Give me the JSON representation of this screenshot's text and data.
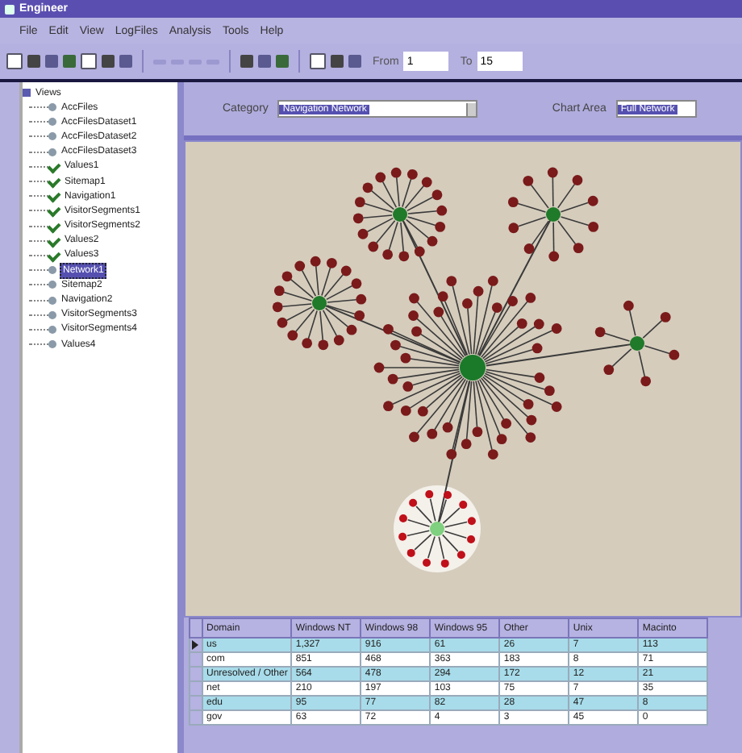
{
  "window": {
    "title": "Engineer"
  },
  "menu": [
    "File",
    "Edit",
    "View",
    "LogFiles",
    "Analysis",
    "Tools",
    "Help"
  ],
  "toolbar": {
    "from_label": "From",
    "from_value": "1",
    "to_label": "To",
    "to_value": "15"
  },
  "tree": {
    "label": "Views",
    "expanded": true,
    "children": [
      {
        "label": "AccFiles",
        "kind": "file",
        "selected": false
      },
      {
        "label": "AccFilesDataset1",
        "kind": "file",
        "selected": false
      },
      {
        "label": "AccFilesDataset2",
        "kind": "file",
        "selected": false
      },
      {
        "label": "AccFilesDataset3",
        "kind": "file",
        "selected": false
      },
      {
        "label": "Values1",
        "kind": "check",
        "selected": false
      },
      {
        "label": "Sitemap1",
        "kind": "check",
        "selected": false
      },
      {
        "label": "Navigation1",
        "kind": "check",
        "selected": false
      },
      {
        "label": "VisitorSegments1",
        "kind": "check",
        "selected": false
      },
      {
        "label": "VisitorSegments2",
        "kind": "check",
        "selected": false
      },
      {
        "label": "Values2",
        "kind": "check",
        "selected": false
      },
      {
        "label": "Values3",
        "kind": "check",
        "selected": false
      },
      {
        "label": "Network1",
        "kind": "file",
        "selected": true
      },
      {
        "label": "Sitemap2",
        "kind": "file",
        "selected": false
      },
      {
        "label": "Navigation2",
        "kind": "file",
        "selected": false
      },
      {
        "label": "VisitorSegments3",
        "kind": "file",
        "selected": false
      },
      {
        "label": "VisitorSegments4",
        "kind": "file",
        "selected": false
      },
      {
        "label": "Values4",
        "kind": "file",
        "selected": false
      }
    ]
  },
  "filters": {
    "category_label": "Category",
    "category_value": "Navigation Network",
    "chart_area_label": "Chart Area",
    "chart_area_value": "Full Network"
  },
  "table": {
    "columns": [
      "Domain",
      "Windows NT",
      "Windows 98",
      "Windows 95",
      "Other",
      "Unix",
      "Macinto"
    ],
    "rows": [
      {
        "selected": true,
        "cells": [
          "us",
          "1,327",
          "916",
          "61",
          "26",
          "7",
          "113"
        ]
      },
      {
        "selected": false,
        "cells": [
          "com",
          "851",
          "468",
          "363",
          "183",
          "8",
          "71"
        ]
      },
      {
        "selected": false,
        "cells": [
          "Unresolved / Other",
          "564",
          "478",
          "294",
          "172",
          "12",
          "21"
        ]
      },
      {
        "selected": false,
        "cells": [
          "net",
          "210",
          "197",
          "103",
          "75",
          "7",
          "35"
        ]
      },
      {
        "selected": false,
        "cells": [
          "edu",
          "95",
          "77",
          "82",
          "28",
          "47",
          "8"
        ]
      },
      {
        "selected": false,
        "cells": [
          "gov",
          "63",
          "72",
          "4",
          "3",
          "45",
          "0"
        ]
      }
    ]
  }
}
